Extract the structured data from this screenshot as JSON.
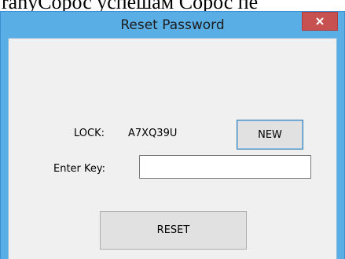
{
  "background_text": "ranyСорос успешам Сорос пе",
  "dialog": {
    "title": "Reset Password",
    "close_glyph": "✕",
    "lock_label": "LOCK:",
    "lock_value": "A7XQ39U",
    "new_button_label": "NEW",
    "enter_key_label": "Enter Key:",
    "key_input_value": "",
    "reset_button_label": "RESET"
  },
  "colors": {
    "titlebar": "#5aaee6",
    "close_button": "#c75050",
    "client_background": "#f0f0f0"
  },
  "icons": {
    "close": "close-icon"
  }
}
